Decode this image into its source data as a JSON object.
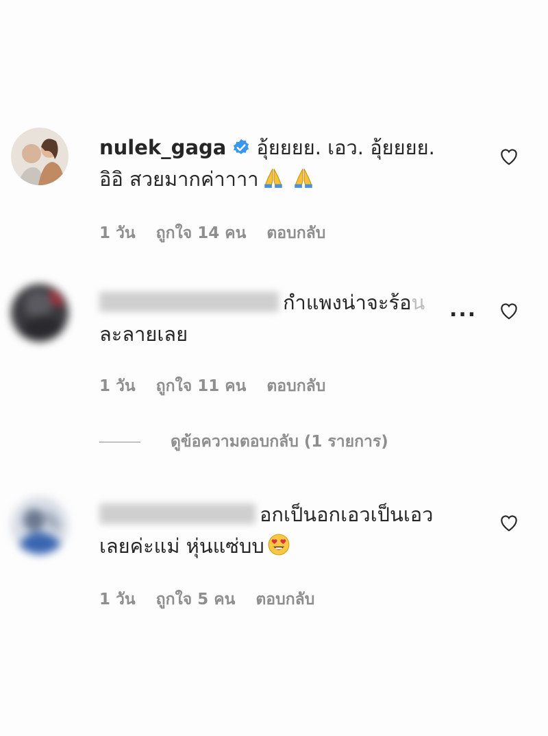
{
  "comments": [
    {
      "username": "nulek_gaga",
      "verified": true,
      "text_line1": "อุ้ยยยย. เอว. อุ้ยยยย.",
      "text_line2": "อิอิ สวยมากค่าาาา",
      "emoji": "folded-hands-icon",
      "time": "1 วัน",
      "likes": "ถูกใจ 14 คน",
      "reply": "ตอบกลับ"
    },
    {
      "username_blurred": true,
      "text_line1": "กำแพงน่าจะร้อ",
      "text_line1_faded": "น",
      "more": "...",
      "text_line2": "ละลายเลย",
      "time": "1 วัน",
      "likes": "ถูกใจ 11 คน",
      "reply": "ตอบกลับ",
      "view_replies": "ดูข้อความตอบกลับ (1 รายการ)"
    },
    {
      "username_blurred": true,
      "text_line1": "อกเป็นอกเอวเป็นเอว",
      "text_line2": "เลยค่ะแม่ หุ่นแซ่บบ",
      "emoji": "heart-eyes-icon",
      "time": "1 วัน",
      "likes": "ถูกใจ 5 คน",
      "reply": "ตอบกลับ"
    }
  ],
  "colors": {
    "text": "#262626",
    "muted": "#8e8e8e",
    "verified": "#3897f0"
  }
}
